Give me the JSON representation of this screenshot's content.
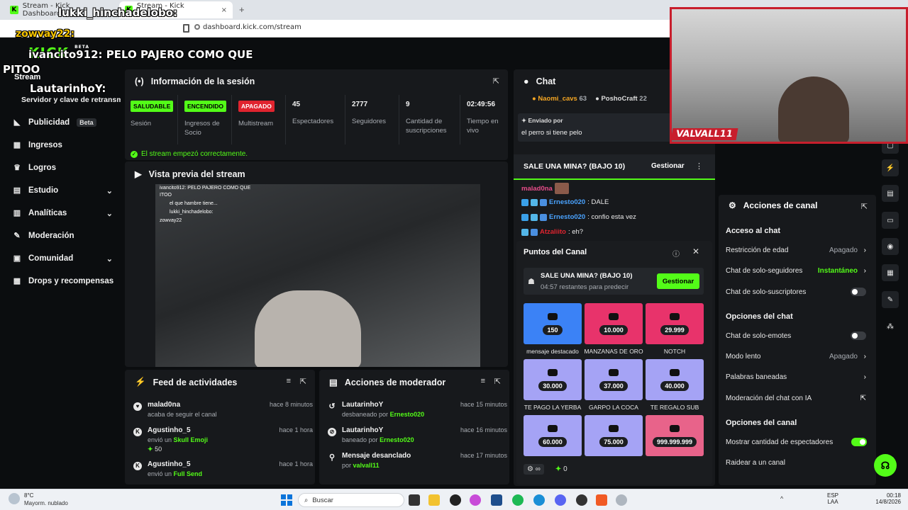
{
  "browser": {
    "tabs": [
      {
        "label": "Stream - Kick Dashboard"
      },
      {
        "label": "Stream - Kick Dashboard"
      }
    ],
    "url": "dashboard.kick.com/stream",
    "add_tab": "+",
    "close_tab": "×"
  },
  "overlay": {
    "lines": [
      {
        "user": "lukki_hinchadelobo:"
      },
      {
        "user": "zowvay22:"
      },
      {
        "user": "ivancito912:",
        "text": "PELO PAJERO COMO QUE"
      },
      {
        "text": "PITOO"
      },
      {
        "user": "LautarinhoY:"
      }
    ]
  },
  "kick": {
    "logo": "KICK",
    "logo_badge": "BETA"
  },
  "sidebar": {
    "stream_label": "Stream",
    "stream_sub": "Servidor y clave de retransm",
    "items": [
      {
        "label": "Publicidad",
        "badge": "Beta",
        "icon": "megaphone-icon"
      },
      {
        "label": "Ingresos",
        "icon": "calendar-icon"
      },
      {
        "label": "Logros",
        "icon": "trophy-icon"
      },
      {
        "label": "Estudio",
        "icon": "studio-icon",
        "chevron": "⌄"
      },
      {
        "label": "Analíticas",
        "icon": "chart-icon",
        "chevron": "⌄"
      },
      {
        "label": "Moderación",
        "icon": "wrench-icon"
      },
      {
        "label": "Comunidad",
        "icon": "community-icon",
        "chevron": "⌄"
      },
      {
        "label": "Drops y recompensas",
        "icon": "drops-icon"
      }
    ]
  },
  "session": {
    "title": "Información de la sesión",
    "stats": [
      {
        "badge": "SALUDABLE",
        "badge_color": "#53fc18",
        "label": "Sesión"
      },
      {
        "badge": "ENCENDIDO",
        "badge_color": "#53fc18",
        "label": "Ingresos de Socio"
      },
      {
        "badge": "APAGADO",
        "badge_color": "#e0242f",
        "label": "Multistream"
      },
      {
        "value": "45",
        "label": "Espectadores"
      },
      {
        "value": "2777",
        "label": "Seguidores"
      },
      {
        "value": "9",
        "label": "Cantidad de suscripciones"
      },
      {
        "value": "02:49:56",
        "label": "Tiempo en vivo"
      }
    ],
    "status": "El stream empezó correctamente."
  },
  "preview": {
    "title": "Vista previa del stream",
    "overlay_lines": [
      "ivancito912: PELO PAJERO COMO QUE",
      "ITOO",
      "el que hambre tiene...",
      "lukki_hinchadelobo:",
      "zowvay22"
    ]
  },
  "feed": {
    "title": "Feed de actividades",
    "rows": [
      {
        "name": "malad0na",
        "sub": "acaba de seguir el canal",
        "time": "hace 8 minutos"
      },
      {
        "name": "Agustinho_5",
        "sub": "envió un",
        "item": "Skull Emoji",
        "amount": "50",
        "time": "hace 1 hora"
      },
      {
        "name": "Agustinho_5",
        "sub": "envió un",
        "item": "Full Send",
        "time": "hace 1 hora"
      }
    ]
  },
  "modactions": {
    "title": "Acciones de moderador",
    "rows": [
      {
        "name": "LautarinhoY",
        "sub": "desbaneado por",
        "by": "Ernesto020",
        "time": "hace 15 minutos"
      },
      {
        "name": "LautarinhoY",
        "sub": "baneado por",
        "by": "Ernesto020",
        "time": "hace 16 minutos"
      },
      {
        "name": "Mensaje desanclado",
        "sub": "por",
        "by": "valvall11",
        "time": "hace 17 minutos"
      }
    ]
  },
  "chat": {
    "title": "Chat",
    "top_users": [
      {
        "name": "Naomi_cavs",
        "count": "63"
      },
      {
        "name": "PoshoCraft",
        "count": "22"
      }
    ],
    "pinned_by": "Enviado por",
    "pinned_text": "el perro si tiene pelo",
    "prediction_title": "SALE UNA MINA? (BAJO 10)",
    "manage": "Gestionar",
    "messages": [
      {
        "user": "malad0na",
        "color": "#e84d8a",
        "text": ""
      },
      {
        "user": "Ernesto020",
        "color": "#4aa3ff",
        "text": ": DALE"
      },
      {
        "user": "Ernesto020",
        "color": "#4aa3ff",
        "text": ": confio esta vez"
      },
      {
        "user": "Atzaliito",
        "color": "#e0242f",
        "text": ": eh?"
      }
    ]
  },
  "points": {
    "title": "Puntos del Canal",
    "prediction_title": "SALE UNA MINA? (BAJO 10)",
    "remaining": "04:57 restantes para predecir",
    "manage": "Gestionar",
    "rewards": [
      {
        "value": "150",
        "label": "mensaje destacado",
        "color": "#3b82f6"
      },
      {
        "value": "10.000",
        "label": "MANZANAS DE ORO",
        "color": "#e8336b"
      },
      {
        "value": "29.999",
        "label": "NOTCH",
        "color": "#e8336b"
      },
      {
        "value": "30.000",
        "label": "TE PAGO LA YERBA",
        "color": "#a5a3f5"
      },
      {
        "value": "37.000",
        "label": "GARPO LA COCA",
        "color": "#a5a3f5"
      },
      {
        "value": "40.000",
        "label": "TE REGALO SUB",
        "color": "#a5a3f5"
      },
      {
        "value": "60.000",
        "label": "",
        "color": "#a5a3f5"
      },
      {
        "value": "75.000",
        "label": "",
        "color": "#a5a3f5"
      },
      {
        "value": "999.999.999",
        "label": "",
        "color": "#e8638a"
      }
    ],
    "footer_count": "0",
    "footer_inf": "∞"
  },
  "channel": {
    "title": "Acciones de canal",
    "access_head": "Acceso al chat",
    "age": "Restricción de edad",
    "age_val": "Apagado",
    "followers": "Chat de solo-seguidores",
    "followers_val": "Instantáneo",
    "subs": "Chat de solo-suscriptores",
    "options_head": "Opciones del chat",
    "emotes": "Chat de solo-emotes",
    "slow": "Modo lento",
    "slow_val": "Apagado",
    "banned": "Palabras baneadas",
    "ai": "Moderación del chat con IA",
    "channel_head": "Opciones del canal",
    "viewers": "Mostrar cantidad de espectadores",
    "raid": "Raidear a un canal"
  },
  "webcam": {
    "caption": "VALVALL11"
  },
  "taskbar": {
    "weather_temp": "8°C",
    "weather_desc": "Mayorm. nublado",
    "search": "Buscar",
    "lang1": "ESP",
    "lang2": "LAA",
    "time": "00:18",
    "date": "14/8/2026"
  }
}
